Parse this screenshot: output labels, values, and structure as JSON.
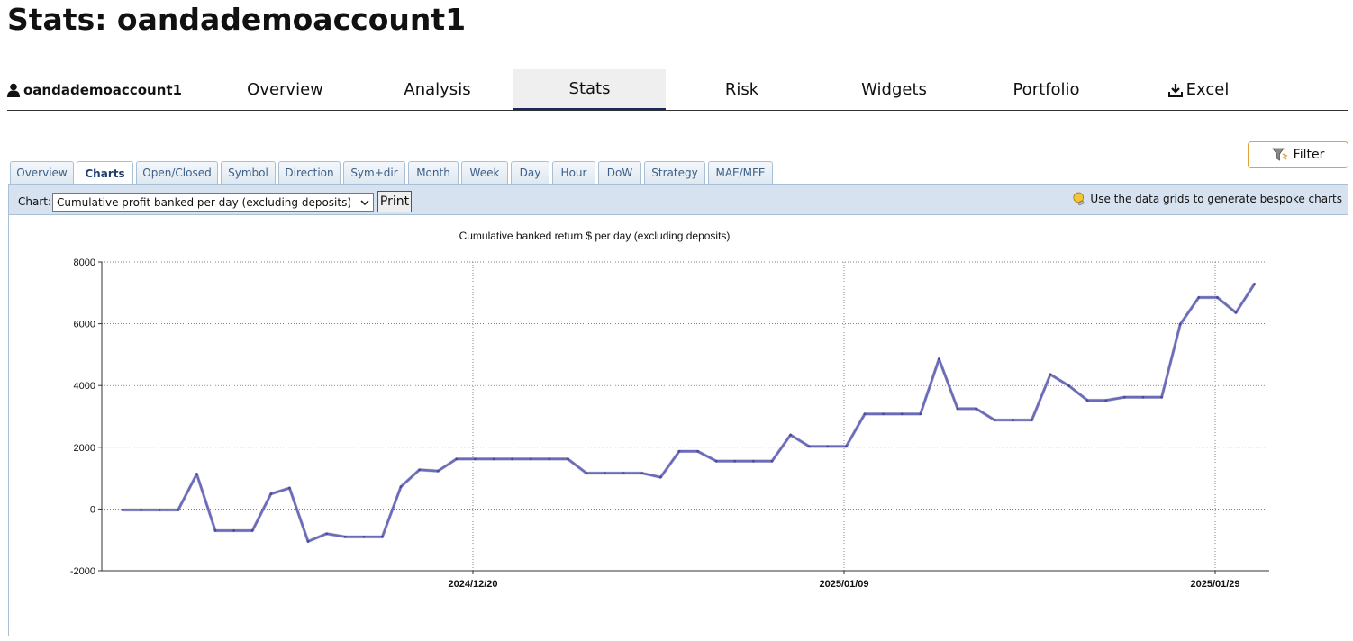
{
  "page": {
    "title": "Stats: oandademoaccount1"
  },
  "nav": {
    "account": "oandademoaccount1",
    "items": [
      {
        "label": "Overview"
      },
      {
        "label": "Analysis"
      },
      {
        "label": "Stats"
      },
      {
        "label": "Risk"
      },
      {
        "label": "Widgets"
      },
      {
        "label": "Portfolio"
      },
      {
        "label": "Excel",
        "icon": "download-icon"
      }
    ],
    "active": "Stats"
  },
  "filter": {
    "label": "Filter",
    "icon": "filter-icon"
  },
  "subtabs": {
    "items": [
      "Overview",
      "Charts",
      "Open/Closed",
      "Symbol",
      "Direction",
      "Sym+dir",
      "Month",
      "Week",
      "Day",
      "Hour",
      "DoW",
      "Strategy",
      "MAE/MFE"
    ],
    "active": "Charts"
  },
  "toolbar": {
    "chart_label": "Chart:",
    "chart_select_value": "Cumulative profit banked per day (excluding deposits)",
    "print_label": "Print",
    "hint": "Use the data grids to generate bespoke charts",
    "hint_icon": "lightbulb-icon"
  },
  "colors": {
    "line": "#6b6bbd",
    "panel_header": "#d6e2ef",
    "tab_border": "#a9bfd6",
    "filter_border": "#e0a43a"
  },
  "chart_data": {
    "type": "line",
    "title": "Cumulative banked return $ per day (excluding deposits)",
    "xlabel": "",
    "ylabel": "",
    "ylim": [
      -2000,
      8000
    ],
    "yticks": [
      -2000,
      0,
      2000,
      4000,
      6000,
      8000
    ],
    "xticks": [
      "2024/12/20",
      "2025/01/09",
      "2025/01/29"
    ],
    "grid": true,
    "series": [
      {
        "values": [
          -30,
          -30,
          -30,
          -30,
          1130,
          -700,
          -700,
          -700,
          490,
          680,
          -1050,
          -800,
          -900,
          -900,
          -900,
          720,
          1270,
          1230,
          1620,
          1620,
          1620,
          1620,
          1620,
          1620,
          1620,
          1160,
          1160,
          1160,
          1160,
          1030,
          1870,
          1870,
          1550,
          1550,
          1550,
          1550,
          2400,
          2030,
          2030,
          2030,
          3080,
          3080,
          3080,
          3080,
          4860,
          3250,
          3250,
          2880,
          2880,
          2880,
          4360,
          3990,
          3520,
          3520,
          3620,
          3620,
          3620,
          5980,
          6850,
          6850,
          6360,
          7290
        ]
      }
    ]
  }
}
